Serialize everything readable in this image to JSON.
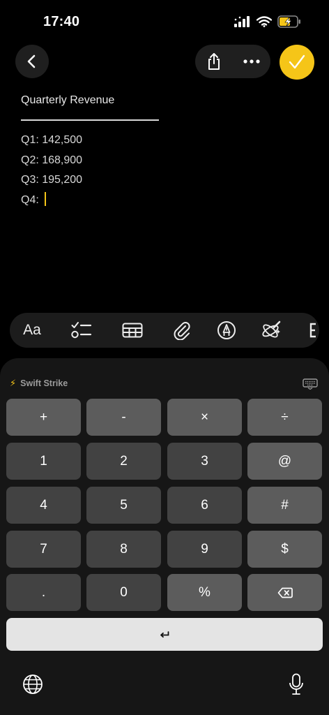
{
  "status_bar": {
    "time": "17:40"
  },
  "toolbar": {
    "back_icon": "chevron-left-icon",
    "share_icon": "share-icon",
    "more_icon": "ellipsis-icon",
    "done_icon": "checkmark-icon"
  },
  "note": {
    "title": "Quarterly Revenue",
    "lines": [
      "Q1: 142,500",
      "Q2: 168,900",
      "Q3: 195,200",
      "Q4: "
    ]
  },
  "format_bar": {
    "text_style_label": "Aa"
  },
  "keyboard": {
    "header_label": "Swift Strike",
    "keys": {
      "plus": "+",
      "minus": "-",
      "times": "×",
      "divide": "÷",
      "one": "1",
      "two": "2",
      "three": "3",
      "at": "@",
      "four": "4",
      "five": "5",
      "six": "6",
      "hash": "#",
      "seven": "7",
      "eight": "8",
      "nine": "9",
      "dollar": "$",
      "dot": ".",
      "zero": "0",
      "percent": "%"
    }
  },
  "colors": {
    "accent": "#f5c518",
    "background": "#000000",
    "key": "#424242",
    "key_function": "#5c5c5c"
  }
}
